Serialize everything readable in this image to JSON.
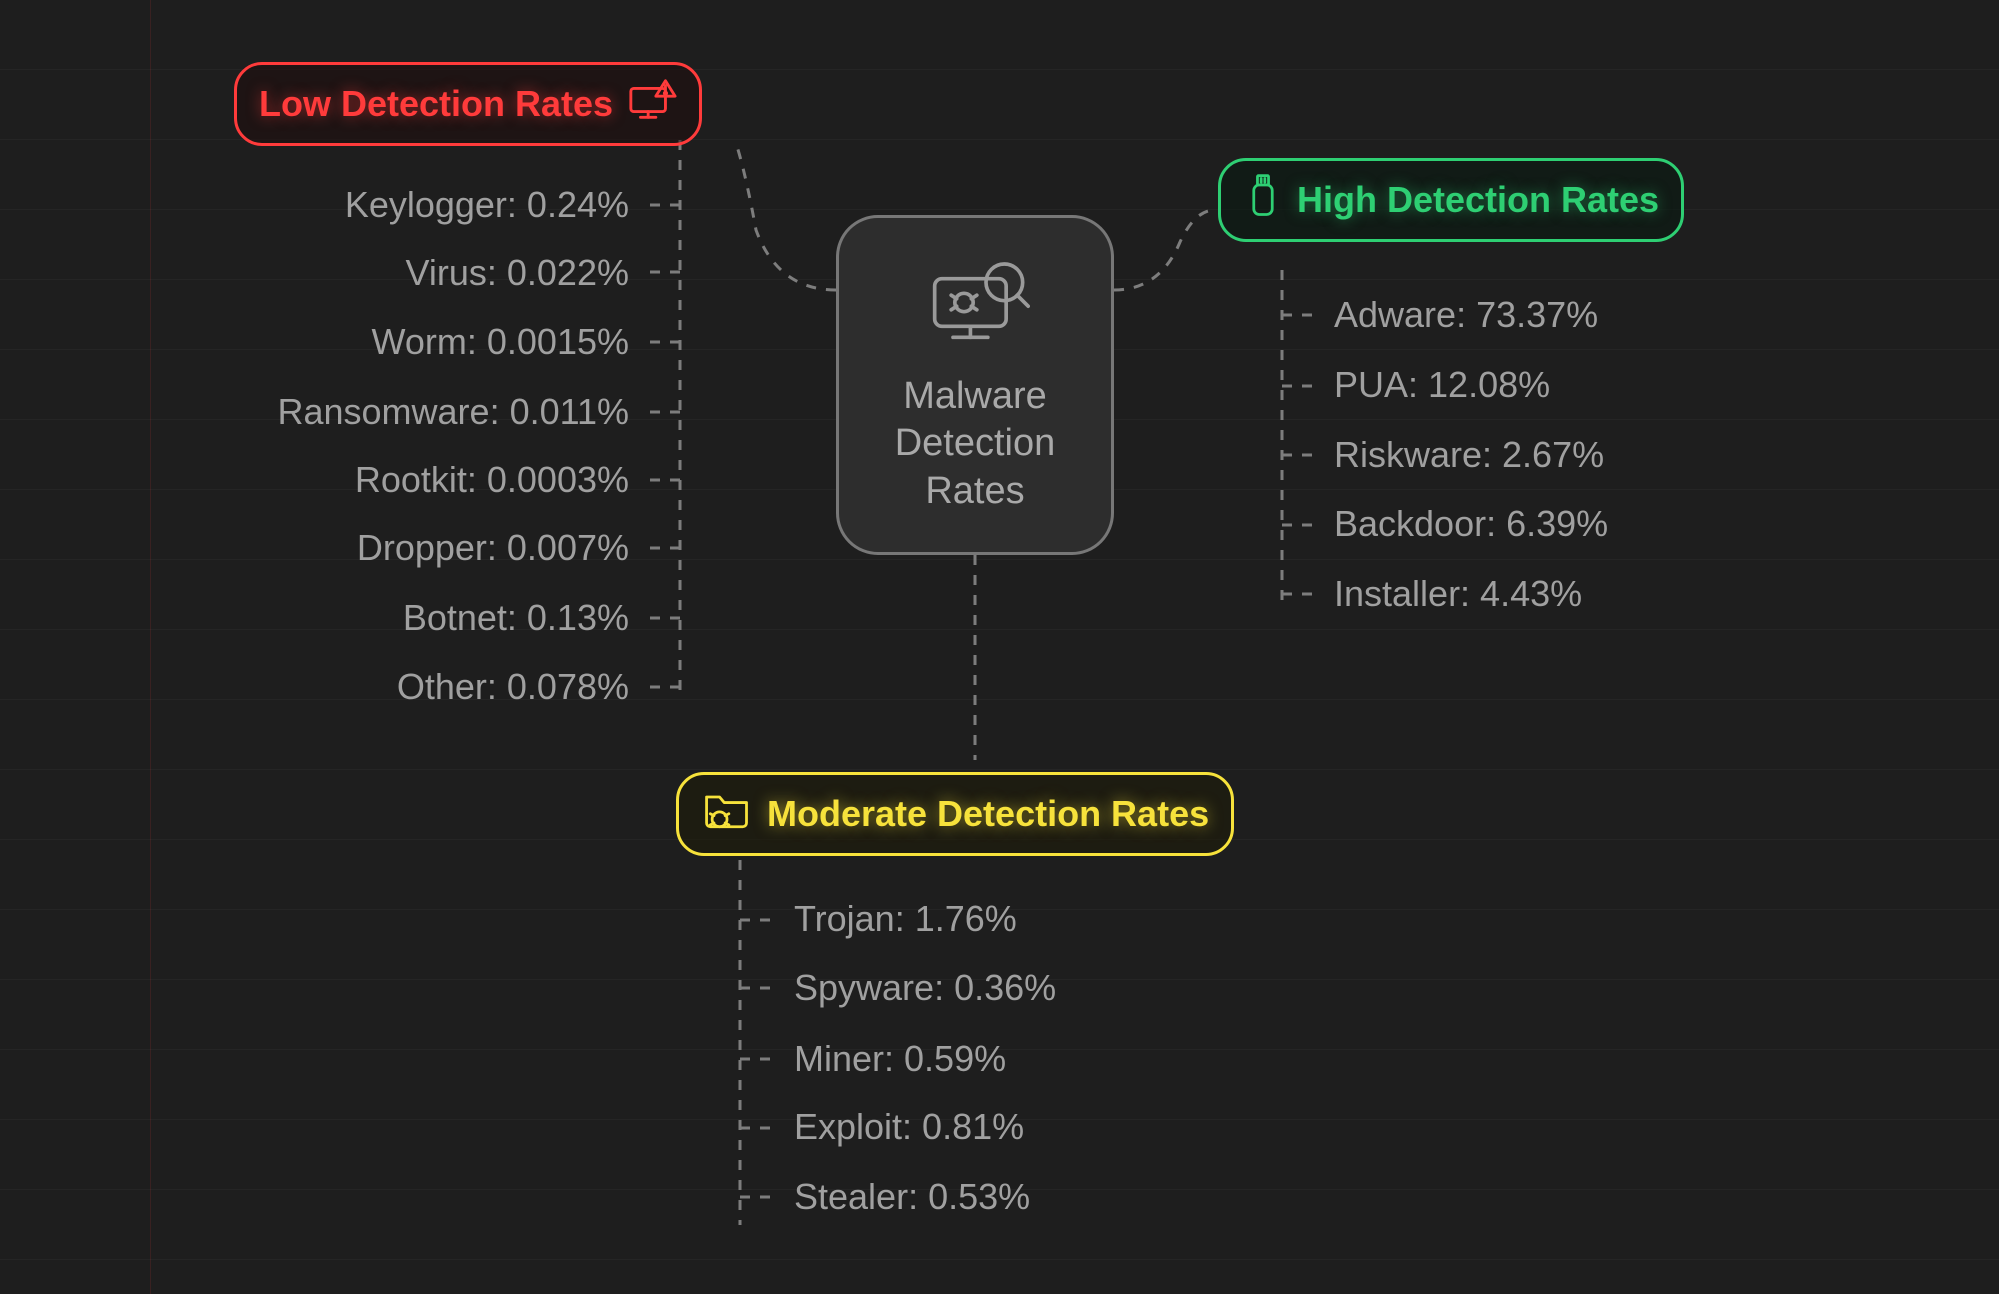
{
  "center": {
    "title_l1": "Malware",
    "title_l2": "Detection",
    "title_l3": "Rates"
  },
  "low": {
    "label": "Low Detection Rates",
    "items": [
      "Keylogger: 0.24%",
      "Virus: 0.022%",
      "Worm: 0.0015%",
      "Ransomware: 0.011%",
      "Rootkit: 0.0003%",
      "Dropper: 0.007%",
      "Botnet: 0.13%",
      "Other: 0.078%"
    ]
  },
  "high": {
    "label": "High Detection Rates",
    "items": [
      "Adware: 73.37%",
      "PUA: 12.08%",
      "Riskware: 2.67%",
      "Backdoor: 6.39%",
      "Installer: 4.43%"
    ]
  },
  "moderate": {
    "label": "Moderate Detection Rates",
    "items": [
      "Trojan: 1.76%",
      "Spyware: 0.36%",
      "Miner: 0.59%",
      "Exploit: 0.81%",
      "Stealer: 0.53%"
    ]
  }
}
